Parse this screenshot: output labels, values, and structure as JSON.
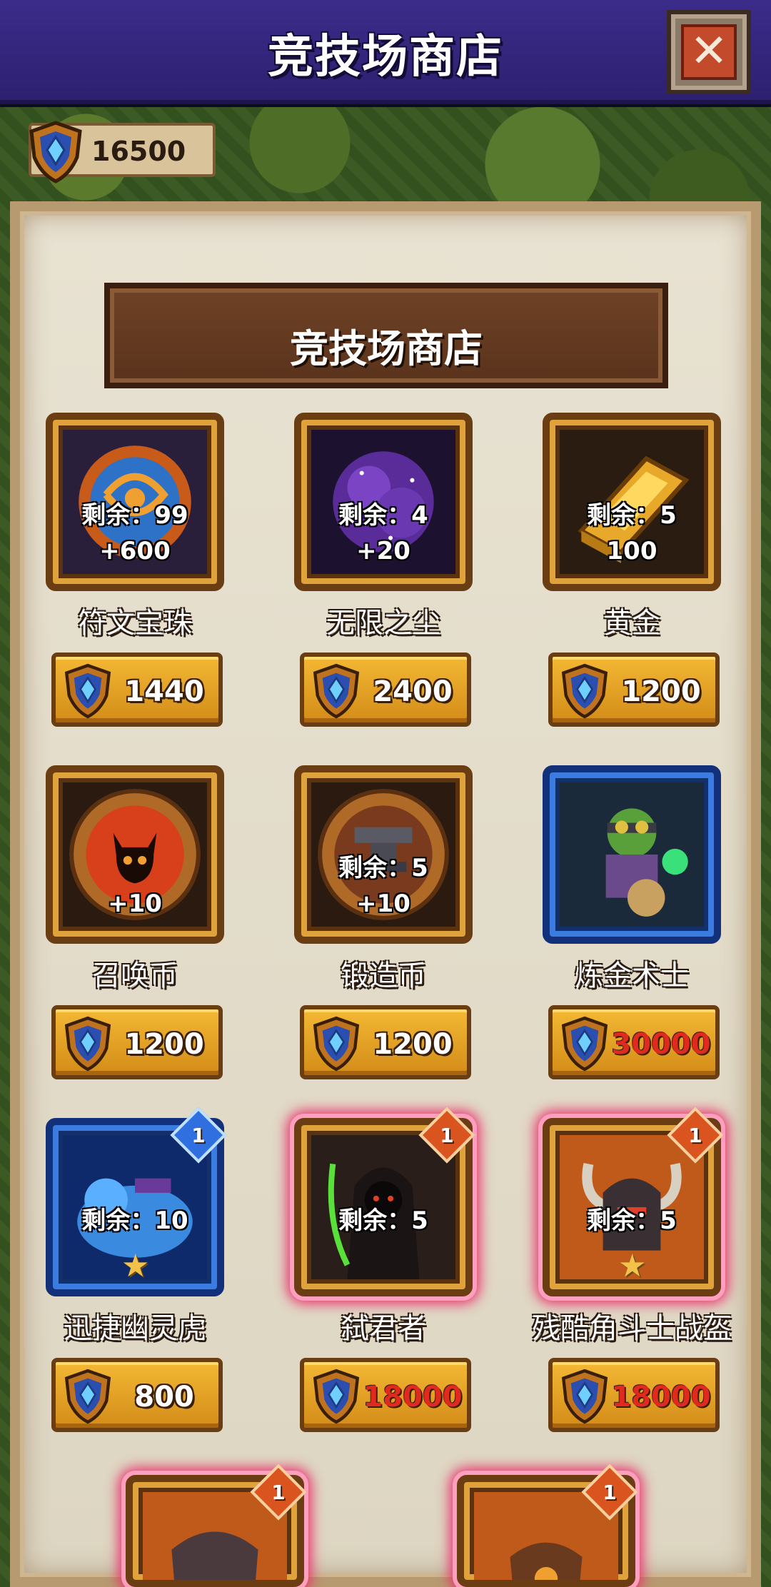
{
  "header": {
    "title": "竞技场商店"
  },
  "currency": {
    "value": "16500"
  },
  "banner": {
    "title": "竞技场商店"
  },
  "items": [
    {
      "name": "符文宝珠",
      "remaining": "剩余：99",
      "amount": "+600",
      "price": "1440",
      "price_color": "white"
    },
    {
      "name": "无限之尘",
      "remaining": "剩余：4",
      "amount": "+20",
      "price": "2400",
      "price_color": "white"
    },
    {
      "name": "黄金",
      "remaining": "剩余：5",
      "amount": "100",
      "price": "1200",
      "price_color": "white"
    },
    {
      "name": "召唤币",
      "amount": "+10",
      "price": "1200",
      "price_color": "white"
    },
    {
      "name": "锻造币",
      "remaining": "剩余：5",
      "amount": "+10",
      "price": "1200",
      "price_color": "white"
    },
    {
      "name": "炼金术士",
      "price": "30000",
      "price_color": "red"
    },
    {
      "name": "迅捷幽灵虎",
      "remaining": "剩余：10",
      "badge": "1",
      "price": "800",
      "price_color": "white"
    },
    {
      "name": "弑君者",
      "remaining": "剩余：5",
      "badge": "1",
      "price": "18000",
      "price_color": "red"
    },
    {
      "name": "残酷角斗士战盔",
      "remaining": "剩余：5",
      "badge": "1",
      "price": "18000",
      "price_color": "red"
    }
  ],
  "partial_items": [
    {
      "badge": "1"
    },
    {
      "badge": "1"
    }
  ],
  "icons": {
    "close": "close-icon",
    "currency": "arena-shield-icon",
    "star": "star-icon"
  },
  "colors": {
    "header_bg": "#3b2c8a",
    "price_button": "#f3b834",
    "price_red": "#e02a20",
    "rarity_orange": "#d9541e",
    "rarity_blue": "#2f6fe0"
  }
}
